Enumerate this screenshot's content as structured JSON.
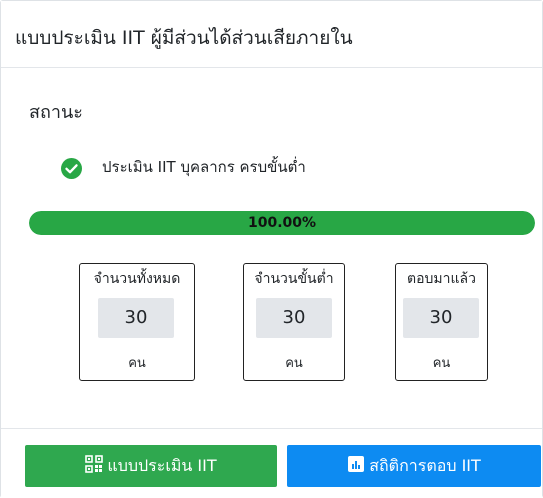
{
  "header": {
    "title": "แบบประเมิน IIT ผู้มีส่วนได้ส่วนเสียภายใน"
  },
  "status": {
    "section_label": "สถานะ",
    "message": "ประเมิน IIT บุคลากร ครบขั้นต่ำ",
    "icon": "check-circle-icon"
  },
  "progress": {
    "value_percent": 100,
    "label": "100.00%",
    "color": "#28a745"
  },
  "stats": [
    {
      "title": "จำนวนทั้งหมด",
      "value": "30",
      "unit": "คน"
    },
    {
      "title": "จำนวนขั้นต่ำ",
      "value": "30",
      "unit": "คน"
    },
    {
      "title": "ตอบมาแล้ว",
      "value": "30",
      "unit": "คน"
    }
  ],
  "buttons": {
    "assessment": {
      "label": "แบบประเมิน IIT",
      "icon": "qrcode-icon",
      "color": "#2fa84f"
    },
    "statistics": {
      "label": "สถิติการตอบ IIT",
      "icon": "bar-chart-icon",
      "color": "#0d8bf2"
    }
  }
}
